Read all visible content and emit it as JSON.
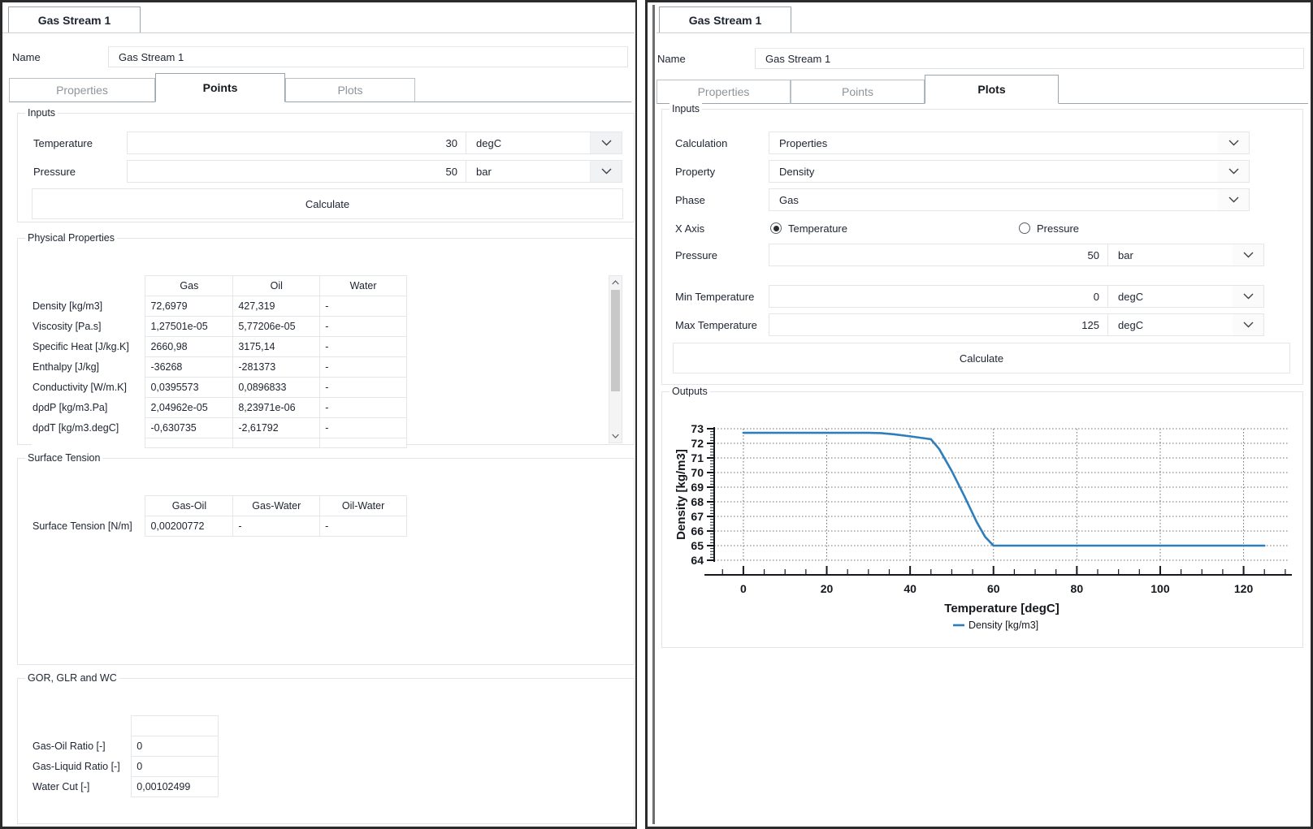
{
  "left_window": {
    "window_tab_label": "Gas Stream 1",
    "name_label": "Name",
    "name_value": "Gas Stream 1",
    "tabs": [
      {
        "label": "Properties",
        "active": false
      },
      {
        "label": "Points",
        "active": true
      },
      {
        "label": "Plots",
        "active": false
      }
    ],
    "inputs": {
      "legend": "Inputs",
      "rows": [
        {
          "label": "Temperature",
          "value": "30",
          "unit": "degC"
        },
        {
          "label": "Pressure",
          "value": "50",
          "unit": "bar"
        }
      ],
      "calculate_label": "Calculate"
    },
    "physical_properties": {
      "legend": "Physical Properties",
      "columns": [
        "",
        "Gas",
        "Oil",
        "Water"
      ],
      "rows": [
        {
          "name": "Density [kg/m3]",
          "gas": "72,6979",
          "oil": "427,319",
          "water": "-"
        },
        {
          "name": "Viscosity [Pa.s]",
          "gas": "1,27501e-05",
          "oil": "5,77206e-05",
          "water": "-"
        },
        {
          "name": "Specific Heat [J/kg.K]",
          "gas": "2660,98",
          "oil": "3175,14",
          "water": "-"
        },
        {
          "name": "Enthalpy [J/kg]",
          "gas": "-36268",
          "oil": "-281373",
          "water": "-"
        },
        {
          "name": "Conductivity [W/m.K]",
          "gas": "0,0395573",
          "oil": "0,0896833",
          "water": "-"
        },
        {
          "name": "dρdP [kg/m3.Pa]",
          "gas": "2,04962e-05",
          "oil": "8,23971e-06",
          "water": "-"
        },
        {
          "name": "dρdT [kg/m3.degC]",
          "gas": "-0,630735",
          "oil": "-2,61792",
          "water": "-"
        },
        {
          "name": "",
          "gas": "",
          "oil": "",
          "water": ""
        }
      ]
    },
    "surface_tension": {
      "legend": "Surface Tension",
      "columns": [
        "",
        "Gas-Oil",
        "Gas-Water",
        "Oil-Water"
      ],
      "rows": [
        {
          "name": "Surface Tension [N/m]",
          "gas_oil": "0,00200772",
          "gas_water": "-",
          "oil_water": "-"
        }
      ]
    },
    "gor_glr_wc": {
      "legend": "GOR, GLR and WC",
      "rows": [
        {
          "name": "Gas-Oil Ratio [-]",
          "value": "0"
        },
        {
          "name": "Gas-Liquid Ratio [-]",
          "value": "0"
        },
        {
          "name": "Water Cut [-]",
          "value": "0,00102499"
        }
      ]
    }
  },
  "right_window": {
    "window_tab_label": "Gas Stream 1",
    "name_label": "Name",
    "name_value": "Gas Stream 1",
    "tabs": [
      {
        "label": "Properties",
        "active": false
      },
      {
        "label": "Points",
        "active": false
      },
      {
        "label": "Plots",
        "active": true
      }
    ],
    "inputs": {
      "legend": "Inputs",
      "calculation_label": "Calculation",
      "calculation_value": "Properties",
      "property_label": "Property",
      "property_value": "Density",
      "phase_label": "Phase",
      "phase_value": "Gas",
      "x_axis_label": "X Axis",
      "x_axis_options": [
        {
          "label": "Temperature",
          "selected": true
        },
        {
          "label": "Pressure",
          "selected": false
        }
      ],
      "pressure_label": "Pressure",
      "pressure_value": "50",
      "pressure_unit": "bar",
      "min_temperature_label": "Min Temperature",
      "min_temperature_value": "0",
      "min_temperature_unit": "degC",
      "max_temperature_label": "Max Temperature",
      "max_temperature_value": "125",
      "max_temperature_unit": "degC",
      "calculate_label": "Calculate"
    },
    "outputs": {
      "legend": "Outputs"
    }
  },
  "chart_data": {
    "type": "line",
    "title": "",
    "xlabel": "Temperature [degC]",
    "ylabel": "Density [kg/m3]",
    "xlim": [
      -7,
      131
    ],
    "ylim": [
      64,
      73
    ],
    "xticks": [
      0,
      20,
      40,
      60,
      80,
      100,
      120
    ],
    "yticks": [
      64,
      65,
      66,
      67,
      68,
      69,
      70,
      71,
      72,
      73
    ],
    "grid": true,
    "legend_position": "bottom-center",
    "series": [
      {
        "name": "Density [kg/m3]",
        "color": "#2e7ebb",
        "x": [
          0,
          5,
          10,
          15,
          20,
          25,
          30,
          33,
          36,
          40,
          43,
          45,
          47,
          50,
          53,
          56,
          58,
          60,
          62,
          70,
          80,
          90,
          100,
          110,
          120,
          125
        ],
        "y": [
          72.72,
          72.72,
          72.72,
          72.72,
          72.72,
          72.72,
          72.72,
          72.7,
          72.62,
          72.48,
          72.36,
          72.28,
          71.6,
          70.1,
          68.4,
          66.6,
          65.6,
          65.0,
          65.0,
          65.0,
          65.0,
          65.0,
          65.0,
          65.0,
          65.0,
          65.0
        ]
      }
    ]
  }
}
